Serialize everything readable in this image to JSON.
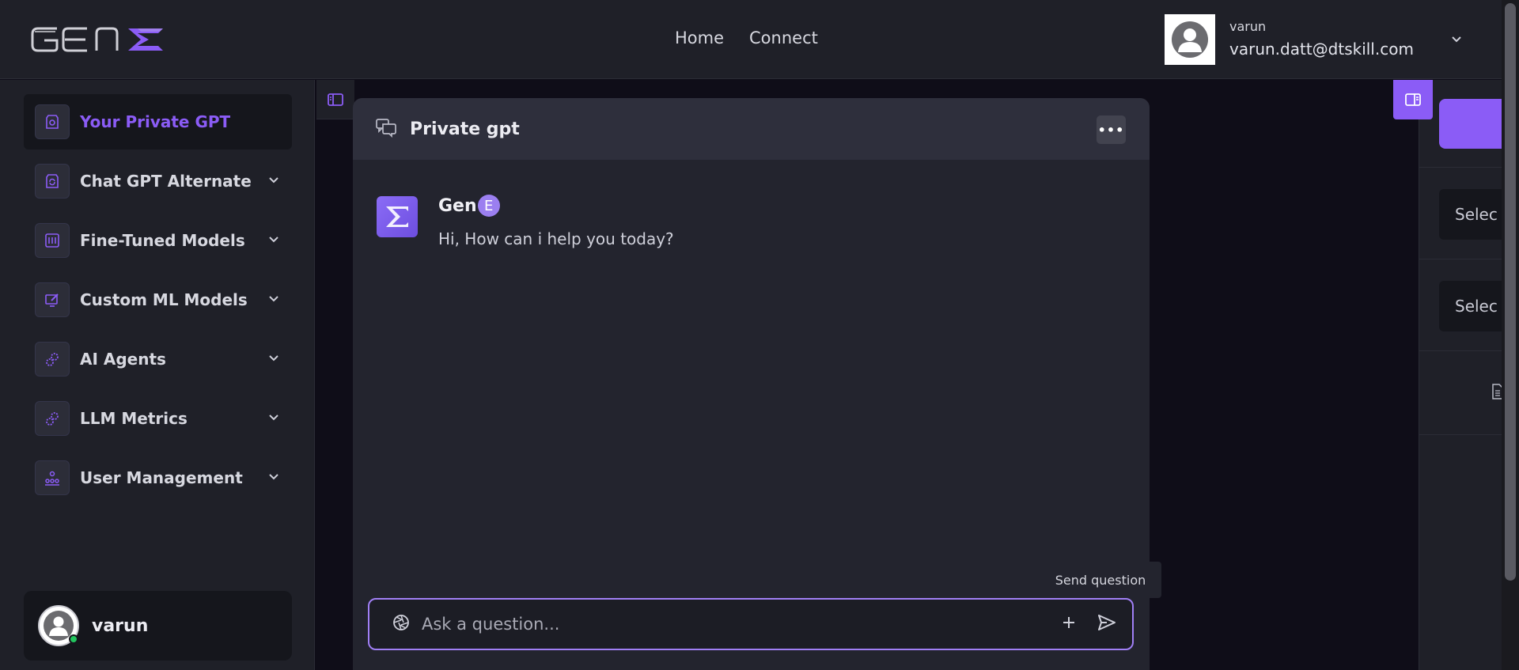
{
  "header": {
    "logo_alt": "GenE",
    "nav": [
      {
        "label": "Home"
      },
      {
        "label": "Connect"
      }
    ],
    "profile": {
      "username": "varun",
      "email": "varun.datt@dtskill.com"
    }
  },
  "sidebar": {
    "items": [
      {
        "label": "Your Private GPT",
        "icon": "shield-icon",
        "active": true
      },
      {
        "label": "Chat GPT Alternate",
        "icon": "refresh-icon"
      },
      {
        "label": "Fine-Tuned Models",
        "icon": "sliders-icon"
      },
      {
        "label": "Custom ML Models",
        "icon": "edit-monitor-icon"
      },
      {
        "label": "AI Agents",
        "icon": "gears-icon"
      },
      {
        "label": "LLM Metrics",
        "icon": "gears-icon"
      },
      {
        "label": "User Management",
        "icon": "users-icon"
      }
    ],
    "user": {
      "name": "varun",
      "status": "online"
    }
  },
  "chat": {
    "title": "Private gpt",
    "bot_name_prefix": "Gen",
    "bot_name_badge": "E",
    "bot_message": "Hi, How can i help you today?",
    "input_placeholder": "Ask a question...",
    "send_tooltip": "Send question"
  },
  "right_panel": {
    "select_1": "Selec",
    "select_2": "Selec"
  },
  "colors": {
    "accent": "#8b5cf6",
    "background": "#1f2028",
    "panel": "#23242e"
  }
}
